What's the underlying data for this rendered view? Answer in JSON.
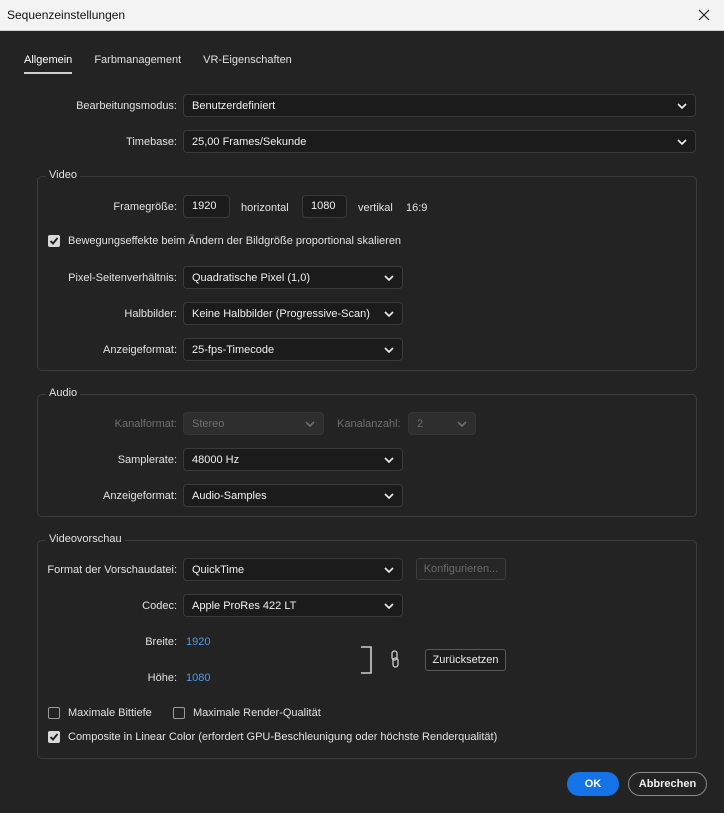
{
  "window": {
    "title": "Sequenzeinstellungen"
  },
  "tabs": [
    {
      "label": "Allgemein",
      "active": true
    },
    {
      "label": "Farbmanagement",
      "active": false
    },
    {
      "label": "VR-Eigenschaften",
      "active": false
    }
  ],
  "general": {
    "editing_mode_label": "Bearbeitungsmodus:",
    "editing_mode_value": "Benutzerdefiniert",
    "timebase_label": "Timebase:",
    "timebase_value": "25,00  Frames/Sekunde"
  },
  "video": {
    "title": "Video",
    "frame_size_label": "Framegröße:",
    "width": "1920",
    "horizontal_label": "horizontal",
    "height": "1080",
    "vertical_label": "vertikal",
    "aspect": "16:9",
    "scale_checkbox_label": "Bewegungseffekte beim Ändern der Bildgröße proportional skalieren",
    "scale_checked": true,
    "pixel_aspect_label": "Pixel-Seitenverhältnis:",
    "pixel_aspect_value": "Quadratische Pixel (1,0)",
    "fields_label": "Halbbilder:",
    "fields_value": "Keine Halbbilder (Progressive-Scan)",
    "display_format_label": "Anzeigeformat:",
    "display_format_value": "25-fps-Timecode"
  },
  "audio": {
    "title": "Audio",
    "channel_format_label": "Kanalformat:",
    "channel_format_value": "Stereo",
    "channel_count_label": "Kanalanzahl:",
    "channel_count_value": "2",
    "sample_rate_label": "Samplerate:",
    "sample_rate_value": "48000 Hz",
    "display_format_label": "Anzeigeformat:",
    "display_format_value": "Audio-Samples"
  },
  "preview": {
    "title": "Videovorschau",
    "file_format_label": "Format der Vorschaudatei:",
    "file_format_value": "QuickTime",
    "configure_label": "Konfigurieren...",
    "codec_label": "Codec:",
    "codec_value": "Apple ProRes 422 LT",
    "width_label": "Breite:",
    "width_value": "1920",
    "height_label": "Höhe:",
    "height_value": "1080",
    "reset_label": "Zurücksetzen",
    "max_bit_depth_label": "Maximale Bittiefe",
    "max_bit_depth_checked": false,
    "max_render_quality_label": "Maximale Render-Qualität",
    "max_render_quality_checked": false,
    "composite_linear_label": "Composite in Linear Color (erfordert GPU-Beschleunigung oder höchste Renderqualität)",
    "composite_linear_checked": true
  },
  "footer": {
    "ok_label": "OK",
    "cancel_label": "Abbrechen"
  },
  "colors": {
    "accent": "#1473e6",
    "link_value": "#4a9bf0",
    "background": "#232323"
  }
}
